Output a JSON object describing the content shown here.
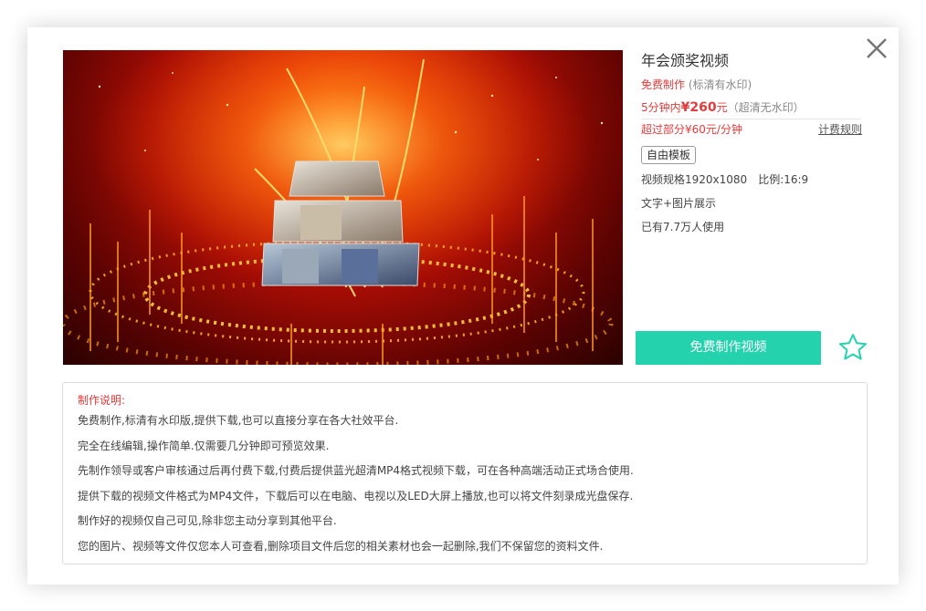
{
  "product": {
    "title": "年会颁奖视频",
    "free_label": "免费制作",
    "free_note": "(标清有水印)",
    "price_prefix": "5分钟内",
    "price_value": "¥260",
    "price_unit": "元",
    "price_note": "（超清无水印）",
    "extra_price": "超过部分¥60元/分钟",
    "rule_link": "计费规则",
    "tag": "自由模板",
    "spec_resolution": "视频规格1920x1080",
    "spec_ratio": "比例:16:9",
    "desc_type": "文字+图片展示",
    "usage": "已有7.7万人使用"
  },
  "actions": {
    "make_button": "免费制作视频",
    "favorite_icon": "star-outline-icon",
    "close_icon": "close-icon"
  },
  "description": {
    "title": "制作说明:",
    "items": [
      "免费制作,标清有水印版,提供下载,也可以直接分享在各大社效平台.",
      "完全在线编辑,操作简单.仅需要几分钟即可预览效果.",
      "先制作领导或客户审核通过后再付费下载,付费后提供蓝光超清MP4格式视频下载，可在各种高端活动正式场合使用.",
      "提供下载的视频文件格式为MP4文件，下载后可以在电脑、电视以及LED大屏上播放,也可以将文件刻录成光盘保存.",
      "制作好的视频仅自己可见,除非您主动分享到其他平台.",
      "您的图片、视频等文件仅您本人可查看,删除项目文件后您的相关素材也会一起删除,我们不保留您的资料文件."
    ]
  },
  "colors": {
    "accent": "#24d2ae",
    "price_red": "#e23b3b",
    "border": "#dcdcdc"
  }
}
